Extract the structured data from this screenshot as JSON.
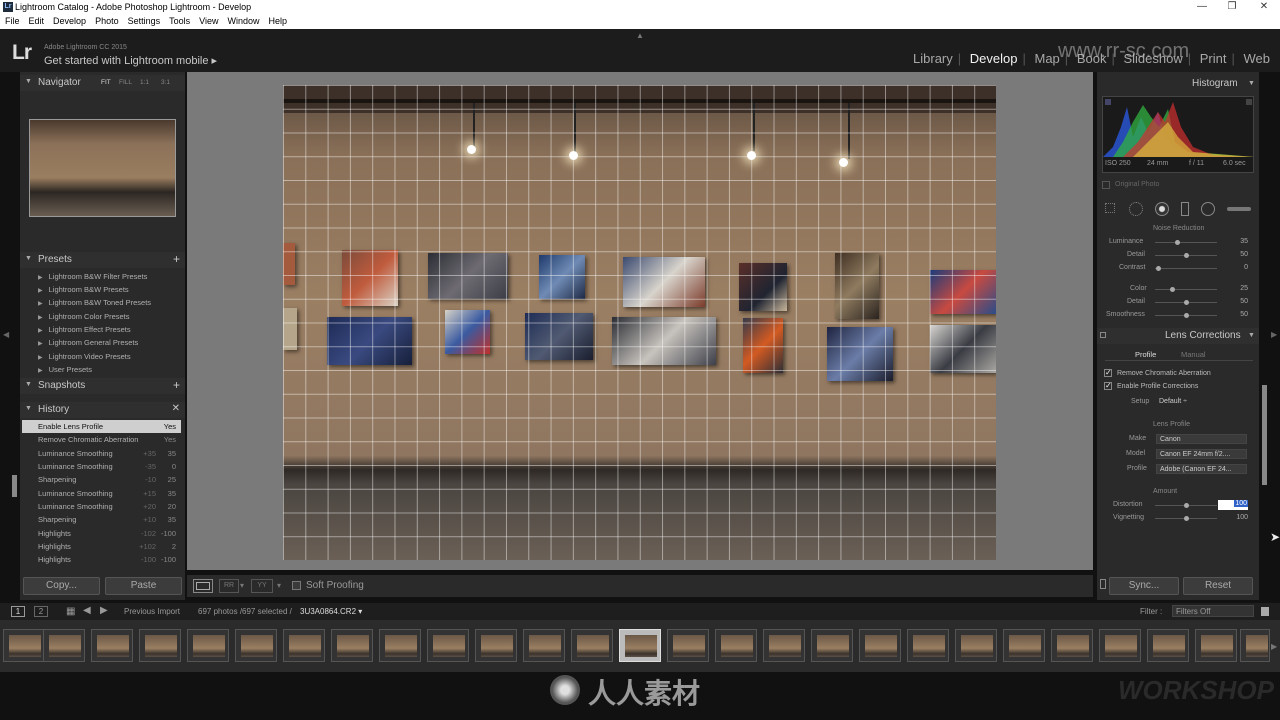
{
  "window": {
    "title": "Lightroom Catalog - Adobe Photoshop Lightroom - Develop",
    "watermark_url": "www.rr-sc.com"
  },
  "menu": [
    "File",
    "Edit",
    "Develop",
    "Photo",
    "Settings",
    "Tools",
    "View",
    "Window",
    "Help"
  ],
  "header": {
    "logo": "Lr",
    "app_version": "Adobe Lightroom CC 2015",
    "mobile": "Get started with Lightroom mobile ▸"
  },
  "modules": [
    "Library",
    "Develop",
    "Map",
    "Book",
    "Slideshow",
    "Print",
    "Web"
  ],
  "navigator": {
    "title": "Navigator",
    "zoom": [
      "FIT",
      "FILL",
      "1:1",
      "3:1"
    ]
  },
  "presets": {
    "title": "Presets",
    "items": [
      "Lightroom B&W Filter Presets",
      "Lightroom B&W Presets",
      "Lightroom B&W Toned Presets",
      "Lightroom Color Presets",
      "Lightroom Effect Presets",
      "Lightroom General Presets",
      "Lightroom Video Presets",
      "User Presets"
    ]
  },
  "snapshots": {
    "title": "Snapshots"
  },
  "history": {
    "title": "History",
    "items": [
      {
        "name": "Enable Lens Profile",
        "a": "",
        "b": "Yes"
      },
      {
        "name": "Remove Chromatic Aberration",
        "a": "",
        "b": "Yes"
      },
      {
        "name": "Luminance Smoothing",
        "a": "+35",
        "b": "35"
      },
      {
        "name": "Luminance Smoothing",
        "a": "-35",
        "b": "0"
      },
      {
        "name": "Sharpening",
        "a": "-10",
        "b": "25"
      },
      {
        "name": "Luminance Smoothing",
        "a": "+15",
        "b": "35"
      },
      {
        "name": "Luminance Smoothing",
        "a": "+20",
        "b": "20"
      },
      {
        "name": "Sharpening",
        "a": "+10",
        "b": "35"
      },
      {
        "name": "Highlights",
        "a": "-102",
        "b": "-100"
      },
      {
        "name": "Highlights",
        "a": "+102",
        "b": "2"
      },
      {
        "name": "Highlights",
        "a": "-100",
        "b": "-100"
      }
    ]
  },
  "left_buttons": {
    "copy": "Copy...",
    "paste": "Paste"
  },
  "toolbar": {
    "soft_proofing": "Soft Proofing"
  },
  "histogram": {
    "title": "Histogram",
    "iso": "ISO 250",
    "focal": "24 mm",
    "aperture": "f / 11",
    "shutter": "6.0 sec",
    "original": "Original Photo"
  },
  "noise": {
    "title": "Noise Reduction",
    "rows": [
      {
        "label": "Luminance",
        "value": "35"
      },
      {
        "label": "Detail",
        "value": "50"
      },
      {
        "label": "Contrast",
        "value": "0"
      },
      {
        "label": "Color",
        "value": "25"
      },
      {
        "label": "Detail",
        "value": "50"
      },
      {
        "label": "Smoothness",
        "value": "50"
      }
    ]
  },
  "lens": {
    "title": "Lens Corrections",
    "tabs": [
      "Profile",
      "Manual"
    ],
    "remove_ca": "Remove Chromatic Aberration",
    "enable_profile": "Enable Profile Corrections",
    "setup_label": "Setup",
    "setup_value": "Default ÷",
    "lens_profile": "Lens Profile",
    "make_label": "Make",
    "make": "Canon",
    "model_label": "Model",
    "model": "Canon EF 24mm f/2....",
    "profile_label": "Profile",
    "profile": "Adobe (Canon EF 24...",
    "amount": "Amount",
    "distortion_label": "Distortion",
    "distortion": "100",
    "vignetting_label": "Vignetting",
    "vignetting": "100"
  },
  "right_buttons": {
    "sync": "Sync...",
    "reset": "Reset"
  },
  "filmstrip_bar": {
    "p1": "1",
    "p2": "2",
    "source": "Previous Import",
    "count": "697 photos /697 selected /",
    "file": "3U3A0864.CR2 ▾",
    "filter_label": "Filter :",
    "filter_value": "Filters Off"
  },
  "brand": {
    "site": "人人素材",
    "workshop": "WORKSHOP"
  }
}
